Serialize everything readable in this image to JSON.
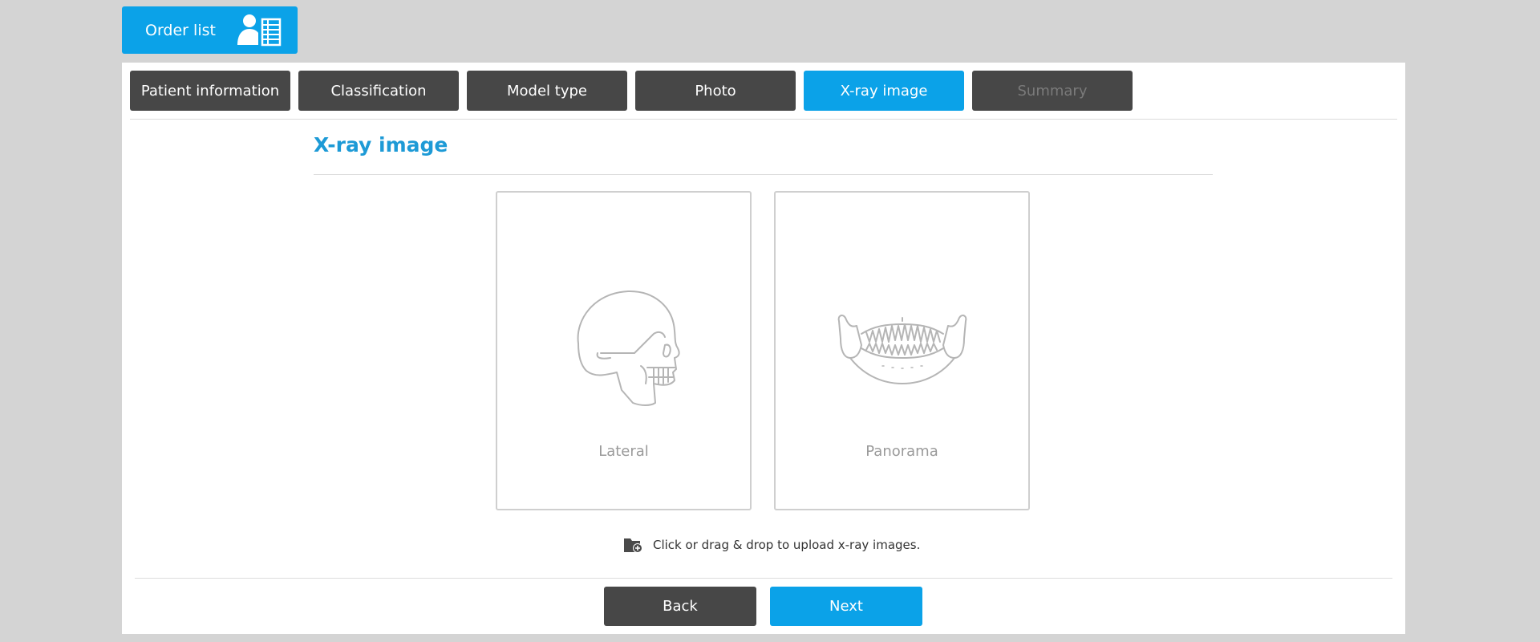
{
  "header": {
    "order_list_label": "Order list",
    "order_list_icon": "user-list-icon"
  },
  "tabs": [
    {
      "label": "Patient information",
      "state": "normal"
    },
    {
      "label": "Classification",
      "state": "normal"
    },
    {
      "label": "Model type",
      "state": "normal"
    },
    {
      "label": "Photo",
      "state": "normal"
    },
    {
      "label": "X-ray image",
      "state": "active"
    },
    {
      "label": "Summary",
      "state": "disabled"
    }
  ],
  "main": {
    "title": "X-ray image",
    "uploads": [
      {
        "label": "Lateral",
        "icon": "skull-lateral-icon"
      },
      {
        "label": "Panorama",
        "icon": "jaw-panorama-icon"
      }
    ],
    "hint_text": "Click or drag & drop to upload x-ray images.",
    "hint_icon": "folder-add-icon"
  },
  "footer": {
    "back_label": "Back",
    "next_label": "Next"
  },
  "colors": {
    "accent": "#0ba2e8",
    "title": "#1d9ad6",
    "tab_dark": "#474747",
    "background": "#d4d4d4"
  }
}
